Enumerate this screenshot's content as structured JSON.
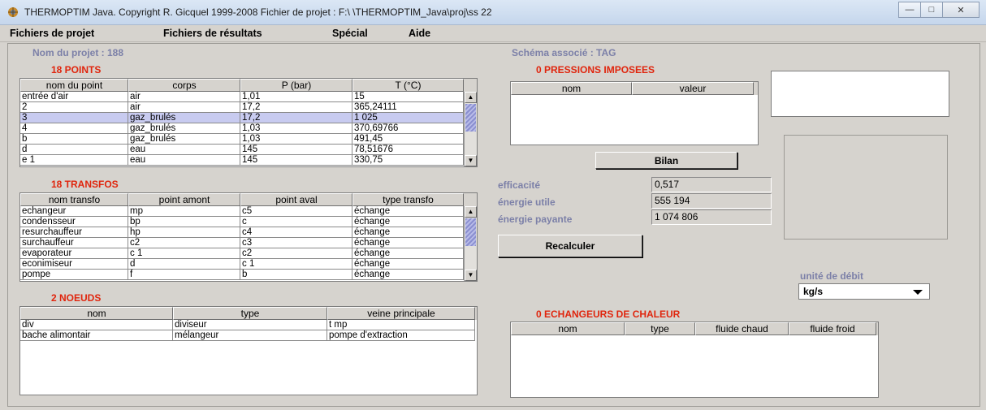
{
  "window": {
    "title": "THERMOPTIM Java.    Copyright R. Gicquel 1999-2008  Fichier de projet : F:\\ \\THERMOPTIM_Java\\proj\\ss 22",
    "buttons": {
      "minimize": "—",
      "maximize": "□",
      "close": "✕"
    }
  },
  "menu": [
    "Fichiers de projet",
    "Fichiers de résultats",
    "Spécial",
    "Aide"
  ],
  "project": {
    "name_label": "Nom du projet : 188",
    "schema_label": "Schéma associé : TAG"
  },
  "points": {
    "title": "18  POINTS",
    "headers": [
      "nom du point",
      "corps",
      "P (bar)",
      "T (°C)"
    ],
    "rows": [
      [
        "entrée d'air",
        "air",
        "1,01",
        "15"
      ],
      [
        "2",
        "air",
        "17,2",
        "365,24111"
      ],
      [
        "3",
        "gaz_brulés",
        "17,2",
        "1 025"
      ],
      [
        "4",
        "gaz_brulés",
        "1,03",
        "370,69766"
      ],
      [
        "b",
        "gaz_brulés",
        "1,03",
        "491,45"
      ],
      [
        "d",
        "eau",
        "145",
        "78,51676"
      ],
      [
        "e 1",
        "eau",
        "145",
        "330,75"
      ]
    ],
    "selected_index": 2
  },
  "transfos": {
    "title": "18  TRANSFOS",
    "headers": [
      "nom transfo",
      "point amont",
      "point aval",
      "type transfo"
    ],
    "rows": [
      [
        "echangeur",
        "mp",
        "c5",
        "échange"
      ],
      [
        "condensseur",
        "bp",
        "c",
        "échange"
      ],
      [
        "resurchauffeur",
        "hp",
        "c4",
        "échange"
      ],
      [
        "surchauffeur",
        "c2",
        "c3",
        "échange"
      ],
      [
        "evaporateur",
        "c 1",
        "c2",
        "échange"
      ],
      [
        "econimiseur",
        "d",
        "c 1",
        "échange"
      ],
      [
        "pompe",
        "f",
        "b",
        "échange"
      ]
    ]
  },
  "noeuds": {
    "title": "2  NOEUDS",
    "headers": [
      "nom",
      "type",
      "veine principale"
    ],
    "rows": [
      [
        "div",
        "diviseur",
        "t mp"
      ],
      [
        "bache alimontair",
        "mélangeur",
        "pompe d'extraction"
      ]
    ]
  },
  "pressions": {
    "title": "0  PRESSIONS IMPOSEES",
    "headers": [
      "nom",
      "valeur"
    ]
  },
  "bilan": {
    "button": "Bilan",
    "efficacite_label": "efficacité",
    "efficacite_value": "0,517",
    "utile_label": "énergie utile",
    "utile_value": "555 194",
    "payante_label": "énergie payante",
    "payante_value": "1 074 806"
  },
  "recalculer": "Recalculer",
  "debit": {
    "label": "unité de débit",
    "value": "kg/s"
  },
  "echangeurs": {
    "title": "0  ECHANGEURS DE CHALEUR",
    "headers": [
      "nom",
      "type",
      "fluide chaud",
      "fluide froid"
    ]
  }
}
